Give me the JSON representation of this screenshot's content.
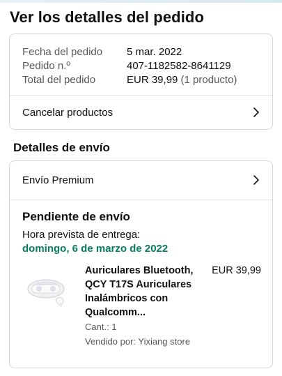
{
  "header": {
    "title": "Ver los detalles del pedido"
  },
  "summary": {
    "date_label": "Fecha del pedido",
    "date_value": "5 mar. 2022",
    "order_label": "Pedido n.º",
    "order_value": "407-1182582-8641129",
    "total_label": "Total del pedido",
    "total_value": "EUR 39,99",
    "total_note": "(1 producto)",
    "cancel_label": "Cancelar productos"
  },
  "shipping": {
    "section_title": "Detalles de envío",
    "method_label": "Envío Premium",
    "status": "Pendiente de envío",
    "eta_label": "Hora prevista de entrega:",
    "eta_date": "domingo, 6 de marzo de 2022"
  },
  "product": {
    "title_lines": [
      "Auriculares Bluetooth,",
      "QCY T17S Auriculares",
      "Inalámbricos con",
      "Qualcomm..."
    ],
    "price": "EUR 39,99",
    "quantity": "Cant.: 1",
    "seller": "Vendido por: Yixiang store"
  },
  "colors": {
    "accent_green": "#067d62",
    "border": "#d5d9d9",
    "muted_text": "#565959"
  },
  "icons": {
    "chevron": "chevron-right-icon",
    "product": "earbuds-product-image"
  }
}
